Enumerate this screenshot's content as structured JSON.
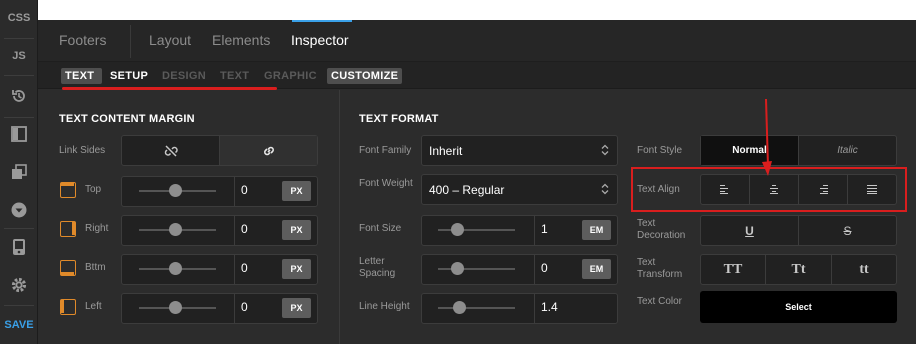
{
  "rail": {
    "css": "CSS",
    "js": "JS",
    "save": "SAVE",
    "icons": [
      "history-icon",
      "panel-icon",
      "layers-icon",
      "dropdown-circle-icon",
      "device-icon",
      "gear-icon"
    ]
  },
  "tabs": {
    "footers": "Footers",
    "layout": "Layout",
    "elements": "Elements",
    "inspector": "Inspector"
  },
  "subtabs": {
    "text": "TEXT",
    "setup": "SETUP",
    "design": "DESIGN",
    "text2": "TEXT",
    "graphic": "GRAPHIC",
    "customize": "CUSTOMIZE"
  },
  "margin": {
    "title": "TEXT CONTENT MARGIN",
    "link_sides": "Link Sides",
    "rows": [
      {
        "label": "Top",
        "value": "0",
        "unit": "PX"
      },
      {
        "label": "Right",
        "value": "0",
        "unit": "PX"
      },
      {
        "label": "Bttm",
        "value": "0",
        "unit": "PX"
      },
      {
        "label": "Left",
        "value": "0",
        "unit": "PX"
      }
    ]
  },
  "format": {
    "title": "TEXT FORMAT",
    "font_family_label": "Font Family",
    "font_family": "Inherit",
    "font_weight_label": "Font Weight",
    "font_weight": "400 – Regular",
    "font_size_label": "Font Size",
    "font_size": "1",
    "font_size_unit": "EM",
    "letter_spacing_label": "Letter Spacing",
    "letter_spacing": "0",
    "letter_spacing_unit": "EM",
    "line_height_label": "Line Height",
    "line_height": "1.4",
    "font_style_label": "Font Style",
    "style_normal": "Normal",
    "style_italic": "Italic",
    "text_align_label": "Text Align",
    "text_decoration_label": "Text Decoration",
    "deco_underline": "U",
    "deco_strike": "S",
    "text_transform_label": "Text Transform",
    "tt_upper": "TT",
    "tt_cap": "Tt",
    "tt_lower": "tt",
    "text_color_label": "Text Color",
    "text_color_select": "Select"
  },
  "colors": {
    "annotation": "#d91e1e",
    "tab_active_line": "#3aa0e8",
    "margin_icon": "#e08a2a",
    "save": "#3aa0e8"
  }
}
